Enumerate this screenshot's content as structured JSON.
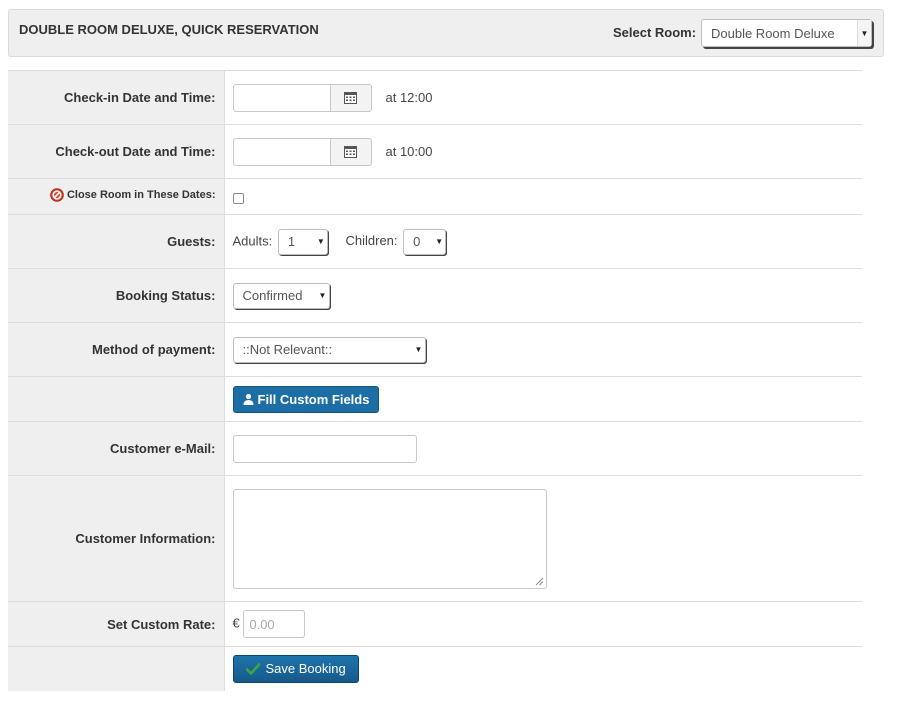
{
  "header": {
    "title": "DOUBLE ROOM DELUXE, QUICK RESERVATION",
    "select_room_label": "Select Room:",
    "select_room_value": "Double Room Deluxe"
  },
  "form": {
    "checkin_label": "Check-in Date and Time:",
    "checkin_value": "",
    "checkin_time": "at 12:00",
    "checkout_label": "Check-out Date and Time:",
    "checkout_value": "",
    "checkout_time": "at 10:00",
    "close_room_label": "Close Room in These Dates:",
    "close_room_checked": false,
    "guests_label": "Guests:",
    "adults_label": "Adults:",
    "adults_value": "1",
    "children_label": "Children:",
    "children_value": "0",
    "status_label": "Booking Status:",
    "status_value": "Confirmed",
    "payment_label": "Method of payment:",
    "payment_value": "::Not Relevant::",
    "fill_custom_fields": "Fill Custom Fields",
    "email_label": "Customer e-Mail:",
    "email_value": "",
    "info_label": "Customer Information:",
    "info_value": "",
    "rate_label": "Set Custom Rate:",
    "currency_symbol": "€",
    "rate_placeholder": "0.00",
    "save_button": "Save Booking"
  },
  "icons": {
    "calendar": "calendar-icon",
    "prohibited": "no-entry-icon",
    "user": "user-icon",
    "check": "check-icon"
  },
  "colors": {
    "label_bg": "#efefef",
    "primary_button": "#1c6ea4",
    "prohibited_red": "#d9402b",
    "check_green": "#3fa63f"
  }
}
